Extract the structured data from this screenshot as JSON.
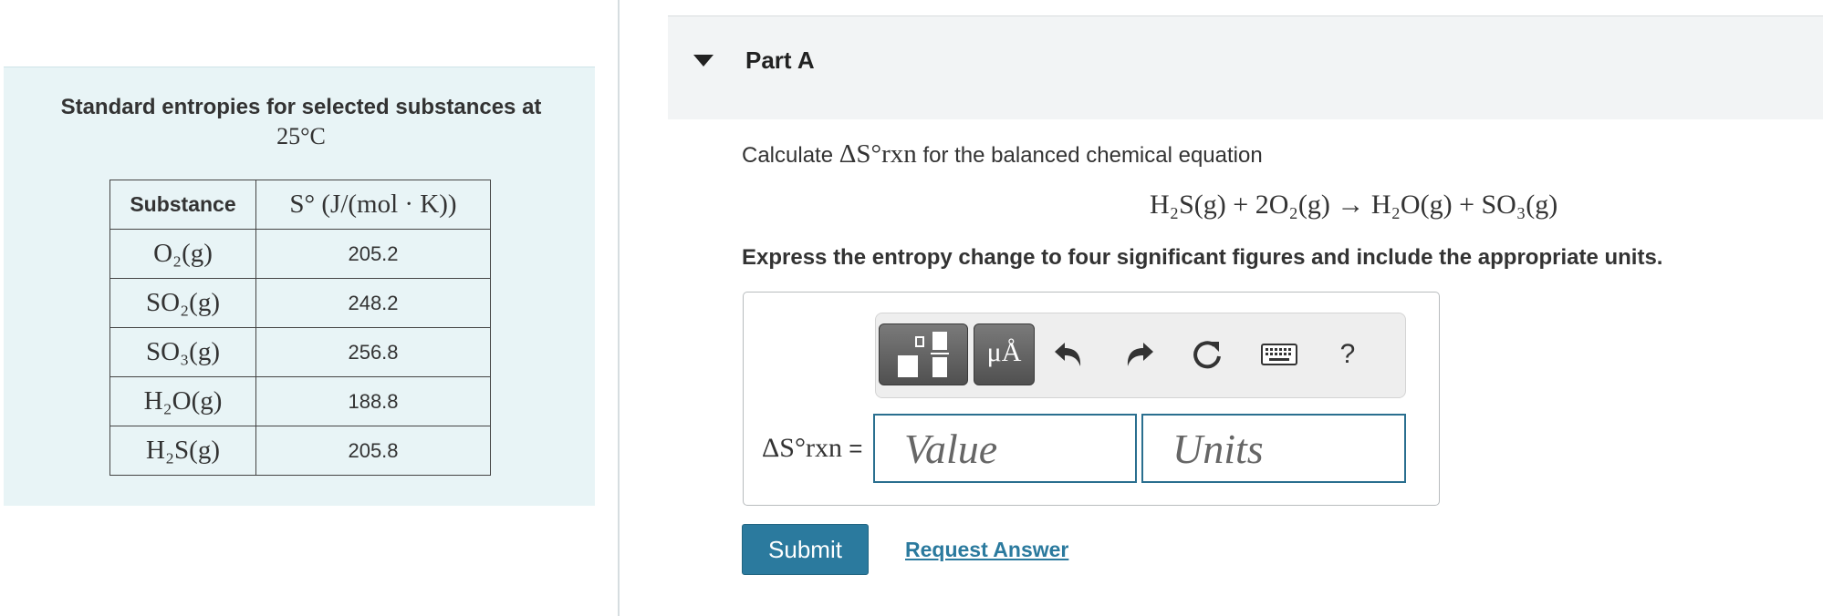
{
  "table": {
    "title": "Standard entropies for selected substances at",
    "title_temp": "25°C",
    "headers": [
      "Substance",
      "S° (J/(mol · K))"
    ],
    "rows": [
      {
        "substance": "O₂(g)",
        "value": "205.2"
      },
      {
        "substance": "SO₂(g)",
        "value": "248.2"
      },
      {
        "substance": "SO₃(g)",
        "value": "256.8"
      },
      {
        "substance": "H₂O(g)",
        "value": "188.8"
      },
      {
        "substance": "H₂S(g)",
        "value": "205.8"
      }
    ]
  },
  "part": {
    "title": "Part A",
    "question_prefix": "Calculate",
    "question_symbol": "ΔS°rxn",
    "question_suffix": "for the balanced chemical equation",
    "equation": "H₂S(g) + 2O₂(g) → H₂O(g) + SO₃(g)",
    "instructions": "Express the entropy change to four significant figures and include the appropriate units."
  },
  "answer": {
    "label_symbol": "ΔS°rxn",
    "label_equals": "=",
    "value_placeholder": "Value",
    "units_placeholder": "Units"
  },
  "toolbar": {
    "symbols_label": "μÅ",
    "help_label": "?",
    "icons": [
      "templates-icon",
      "symbols-icon",
      "undo-icon",
      "redo-icon",
      "reset-icon",
      "keyboard-icon",
      "help-icon"
    ]
  },
  "actions": {
    "submit_label": "Submit",
    "request_answer_label": "Request Answer"
  },
  "colors": {
    "panel_background": "#e8f4f6",
    "accent": "#2b7a9e",
    "input_border": "#2a6f8f"
  }
}
